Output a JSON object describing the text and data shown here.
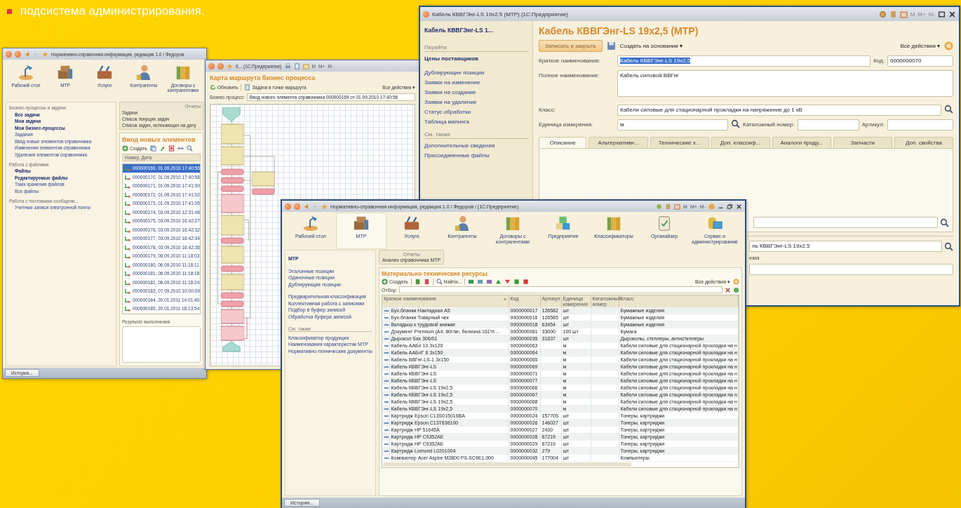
{
  "caption": {
    "text": "подсистема администрирования."
  },
  "tasks_window": {
    "title": "Нормативно-справочная информация, редакция 1.0 / Федоров",
    "sections": [
      {
        "label": "Рабочий стол",
        "kind": "lamp",
        "selected": false
      },
      {
        "label": "МТР",
        "kind": "boxes",
        "selected": false
      },
      {
        "label": "Услуги",
        "kind": "toolbox",
        "selected": false
      },
      {
        "label": "Контрагенты",
        "kind": "person",
        "selected": false
      },
      {
        "label": "Договоры с контрагентами",
        "kind": "binders",
        "selected": false
      }
    ],
    "nav_groups": [
      {
        "title": "Бизнес-процессы и задачи",
        "items": [
          {
            "label": "Все задачи",
            "emphasized": true
          },
          {
            "label": "Мои задачи",
            "emphasized": true
          },
          {
            "label": "Мои бизнес-процессы",
            "emphasized": true
          },
          {
            "label": "Задания",
            "emphasized": false
          },
          {
            "label": "Ввод новых элементов справочника",
            "emphasized": false
          },
          {
            "label": "Изменения элементов справочника",
            "emphasized": false
          },
          {
            "label": "Удаления элементов справочника",
            "emphasized": false
          }
        ]
      },
      {
        "title": "Работа с файлами",
        "items": [
          {
            "label": "Файлы",
            "emphasized": true
          },
          {
            "label": "Редактируемые файлы",
            "emphasized": true
          },
          {
            "label": "Тома хранения файлов",
            "emphasized": false
          },
          {
            "label": "Все файлы",
            "emphasized": false
          }
        ]
      },
      {
        "title": "Работа с почтовыми сообщени...",
        "items": [
          {
            "label": "Учетные записи электронной почты",
            "emphasized": false
          }
        ]
      }
    ],
    "reports": {
      "title": "Отчеты",
      "items": [
        "Задачи",
        "Список текущих задач",
        "Список задач, истекающих на дату"
      ]
    },
    "list": {
      "title": "Ввод новых элементов",
      "create": "Создать",
      "column": "Номер, Дата",
      "rows": [
        {
          "text": "000000169, 01.09.2010 17:40:56",
          "selected": true
        },
        {
          "text": "000000170, 01.09.2010 17:40:58",
          "selected": false
        },
        {
          "text": "000000171, 01.09.2010 17:41:00",
          "selected": false
        },
        {
          "text": "000000172, 01.09.2010 17:41:02",
          "selected": false
        },
        {
          "text": "000000173, 01.09.2010 17:41:05",
          "selected": false
        },
        {
          "text": "000000174, 03.09.2010 12:31:48",
          "selected": false
        },
        {
          "text": "000000175, 03.09.2010 16:42:27",
          "selected": false
        },
        {
          "text": "000000176, 03.09.2010 16:42:32",
          "selected": false
        },
        {
          "text": "000000177, 03.09.2010 16:42:34",
          "selected": false
        },
        {
          "text": "000000178, 03.09.2010 16:42:36",
          "selected": false
        },
        {
          "text": "000000179, 06.09.2010 11:18:03",
          "selected": false
        },
        {
          "text": "000000180, 06.09.2010 11:18:11",
          "selected": false
        },
        {
          "text": "000000181, 06.09.2010 11:18:18",
          "selected": false
        },
        {
          "text": "000000182, 06.09.2010 11:18:24",
          "selected": false
        },
        {
          "text": "000000183, 07.09.2010 10:00:09",
          "selected": false
        },
        {
          "text": "000000184, 20.01.2011 14:01:40",
          "selected": false
        },
        {
          "text": "000000185, 20.01.2011 18:13:54",
          "selected": false
        }
      ]
    },
    "result_label": "Результат выполнения",
    "history": "История..."
  },
  "route_window": {
    "title": "К... (1С:Предприятие)",
    "memory_buttons": [
      "M",
      "M+",
      "M-"
    ],
    "heading": "Карта маршрута бизнес процесса",
    "refresh": "Обновить",
    "tasks_button": "Задачи в точке маршрута",
    "all_actions": "Все действия ▾",
    "process_label": "Бизнес-процесс:",
    "process_value": "Ввод нового элемента справочника 000000169 от 01.09.2010 17:40:56"
  },
  "item_window": {
    "title": "Кабель КВВГЭнг-LS 19x2.5 (МТР)  (1С:Предприятие)",
    "memory_buttons": [
      "M",
      "M+",
      "M-"
    ],
    "sidebar": {
      "title": "Кабель КВВГЭнг-LS 1...",
      "go_label": "Перейти",
      "go_items": [
        {
          "label": "Цены поставщиков",
          "emphasized": true
        },
        {
          "label": "Дублирующие позиции",
          "emphasized": false
        },
        {
          "label": "Заявки на изменение",
          "emphasized": false
        },
        {
          "label": "Заявки на создание",
          "emphasized": false
        },
        {
          "label": "Заявки на удаление",
          "emphasized": false
        },
        {
          "label": "Статус обработки",
          "emphasized": false
        },
        {
          "label": "Таблица мапинга",
          "emphasized": false
        }
      ],
      "see_also_label": "См. также",
      "see_also_items": [
        "Дополнительные сведения",
        "Присоединенные файлы"
      ]
    },
    "heading": "Кабель КВВГЭнг-LS 19х2,5 (МТР)",
    "save_close": "Записать и закрыть",
    "create_based": "Создать на основании ▾",
    "all_actions": "Все действия ▾",
    "short_name": {
      "label": "Краткое наименование:",
      "value": "Кабель КВВГЭнг-LS 19х2,5",
      "selected": true
    },
    "code": {
      "label": "Код:",
      "value": "0000000070"
    },
    "full_name": {
      "label": "Полное наименование:",
      "value": "Кабель силовой ВВГнг"
    },
    "class": {
      "label": "Класс:",
      "value": "Кабели силовые для стационарной прокладки на напряжение до 1 кВ"
    },
    "unit": {
      "label": "Единица измерения:",
      "value": "м"
    },
    "catalog_number": {
      "label": "Каталожный номер:"
    },
    "article": {
      "label": "Артикул:"
    },
    "tabs": [
      {
        "label": "Описание",
        "selected": true
      },
      {
        "label": "Альтернативн...",
        "selected": false
      },
      {
        "label": "Технические х...",
        "selected": false
      },
      {
        "label": "Доп. классиф...",
        "selected": false
      },
      {
        "label": "Аналоги проду...",
        "selected": false
      },
      {
        "label": "Запчасти",
        "selected": false
      },
      {
        "label": "Доп. свойства",
        "selected": false
      }
    ],
    "lower_field_value": "ль КВВГЭнг-LS 19х2.5",
    "lower_label": "ема"
  },
  "catalog_window": {
    "title": "Нормативно-справочная информация, редакция 1.0 / Федоров / (1С:Предприятие)",
    "memory_buttons": [
      "M",
      "M+",
      "M-"
    ],
    "sections": [
      {
        "label": "Рабочий стол",
        "kind": "lamp",
        "selected": false
      },
      {
        "label": "МТР",
        "kind": "boxes",
        "selected": true
      },
      {
        "label": "Услуги",
        "kind": "toolbox",
        "selected": false
      },
      {
        "label": "Контрагенты",
        "kind": "person",
        "selected": false
      },
      {
        "label": "Договоры с контрагентами",
        "kind": "binders",
        "selected": false
      },
      {
        "label": "Предприятие",
        "kind": "cubes",
        "selected": false
      },
      {
        "label": "Классификаторы",
        "kind": "binders",
        "selected": false
      },
      {
        "label": "Органайзер",
        "kind": "clipboard",
        "selected": false
      },
      {
        "label": "Сервис и администрирование",
        "kind": "server",
        "selected": false
      }
    ],
    "nav": {
      "title": "МТР",
      "groups": [
        [
          "Эталонные позиции",
          "Одиночные позиции",
          "Дублирующие позиции"
        ],
        [
          "Предварительная классификация",
          "Коллективная работа с записями",
          "Подбор в буфер записей",
          "Обработка буфера записей"
        ]
      ],
      "see_also_label": "См. также",
      "see_also": [
        "Классификатор продукции",
        "Наименования характеристик МТР",
        "Нормативно-технические документы"
      ]
    },
    "reports": {
      "title": "Отчеты",
      "item": "Анализ справочника МТР"
    },
    "heading": "Материально-технические ресурсы",
    "create": "Создать",
    "find": "Найти...",
    "all_actions": "Все действия ▾",
    "filter_label": "Отбор:",
    "columns": [
      "Краткое наименование",
      "Код",
      "Артикул",
      "Единица измерения",
      "Каталожный номер",
      "Класс"
    ],
    "rows": [
      [
        "Бух.бланки Накладная А5",
        "0000000017",
        "126582",
        "шт",
        "",
        "Бумажные изделия"
      ],
      [
        "Бух.бланки Товарный чек",
        "0000000016",
        "126585",
        "шт",
        "",
        "Бумажные изделия"
      ],
      [
        "Вкладыш к трудовой книжке",
        "0000000018",
        "63454",
        "шт",
        "",
        "Бумажные изделия"
      ],
      [
        "Документ Premium (А4, 80г/м², белизна 161% ...",
        "0000000081",
        "33000",
        "100 шт",
        "",
        "Бумага"
      ],
      [
        "Дырокол Sax 306/01",
        "0000000035",
        "31837",
        "шт",
        "",
        "Дыроколы, степлеры, антистеплеры"
      ],
      [
        "Кабель ААБл 10 3х120",
        "0000000063",
        "",
        "м",
        "",
        "Кабели силовые для стационарной прокладки на н"
      ],
      [
        "Кабель ААБлГ 6 3х150",
        "0000000064",
        "",
        "м",
        "",
        "Кабели силовые для стационарной прокладки на н"
      ],
      [
        "Кабель ВВГнг-LS-1 3х150",
        "0000000065",
        "",
        "м",
        "",
        "Кабели силовые для стационарной прокладки на н"
      ],
      [
        "Кабель КВВГЭнг-LS",
        "0000000069",
        "",
        "м",
        "",
        "Кабели силовые для стационарной прокладки на н"
      ],
      [
        "Кабель КВВГЭнг-LS",
        "0000000071",
        "",
        "м",
        "",
        "Кабели силовые для стационарной прокладки на н"
      ],
      [
        "Кабель КВВГЭнг-LS",
        "0000000077",
        "",
        "м",
        "",
        "Кабели силовые для стационарной прокладки на н"
      ],
      [
        "Кабель КВВГЭнг-LS 19х2,5",
        "0000000066",
        "",
        "м",
        "",
        "Кабели силовые для стационарной прокладки на н"
      ],
      [
        "Кабель КВВГЭнг-LS 19х2,5",
        "0000000067",
        "",
        "м",
        "",
        "Кабели силовые для стационарной прокладки на н"
      ],
      [
        "Кабель КВВГЭнг-LS 19х2,5",
        "0000000068",
        "",
        "м",
        "",
        "Кабели силовые для стационарной прокладки на н"
      ],
      [
        "Кабель КВВГЭнг-LS 19х2,5",
        "0000000070",
        "",
        "м",
        "",
        "Кабели силовые для стационарной прокладки на н"
      ],
      [
        "Картридж Epson C13S015016BA",
        "0000000024",
        "157705",
        "шт",
        "",
        "Тонеры, картриджи"
      ],
      [
        "Картридж Epson C13T636100",
        "0000000026",
        "146027",
        "шт",
        "",
        "Тонеры, картриджи"
      ],
      [
        "Картридж HP 51645A",
        "0000000027",
        "2430",
        "шт",
        "",
        "Тонеры, картриджи"
      ],
      [
        "Картридж HP C9352AE",
        "0000000028",
        "67219",
        "шт",
        "",
        "Тонеры, картриджи"
      ],
      [
        "Картридж HP C9352AE",
        "0000000029",
        "67219",
        "шт",
        "",
        "Тонеры, картриджи"
      ],
      [
        "Картридж Lomond L0201004",
        "0000000032",
        "279",
        "шт",
        "",
        "Тонеры, картриджи"
      ],
      [
        "Компьютер Acer Aspire M3800 PS.SC9E1.000",
        "0000000045",
        "177004",
        "шт",
        "",
        "Компьютеры"
      ]
    ],
    "history": "История..."
  }
}
